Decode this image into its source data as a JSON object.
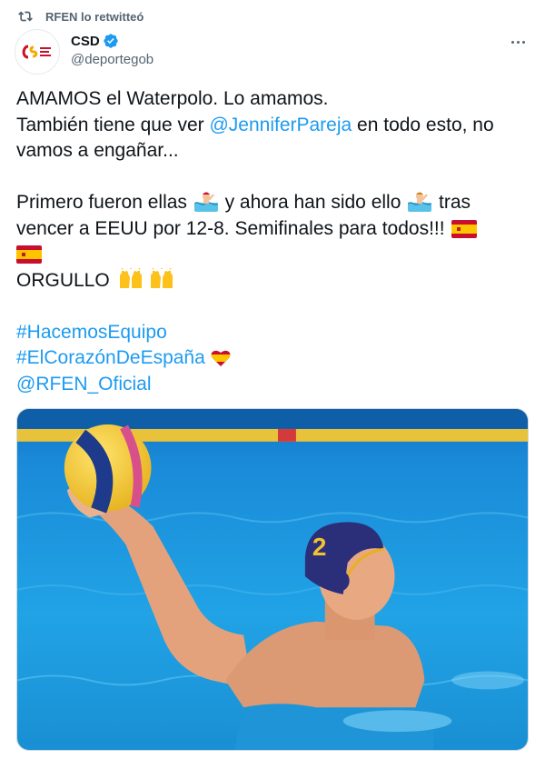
{
  "social_context": {
    "text": "RFEN lo retwitteó",
    "icon": "retweet-icon"
  },
  "author": {
    "name": "CSD",
    "handle": "@deportegob",
    "verified": true,
    "avatar_icon": "csd-logo"
  },
  "tweet": {
    "line1": "AMAMOS el Waterpolo. Lo amamos.",
    "line2_pre": "También tiene que ver ",
    "mention_jennifer": "@JenniferPareja",
    "line2_post": " en todo esto, no",
    "line3": "vamos a engañar...",
    "line4_a": "Primero fueron ellas ",
    "line4_b": " y ahora han sido ello ",
    "line4_c": " tras",
    "line5": "vencer a EEUU por 12-8. Semifinales para todos!!! ",
    "line7": "ORGULLO ",
    "hashtag1": "#HacemosEquipo",
    "hashtag2": "#ElCorazónDeEspaña",
    "mention_rfen": "@RFEN_Oficial"
  },
  "media": {
    "cap_number": "2"
  },
  "colors": {
    "link": "#1d9bf0",
    "secondary": "#536471",
    "pool": "#1e9be0"
  }
}
